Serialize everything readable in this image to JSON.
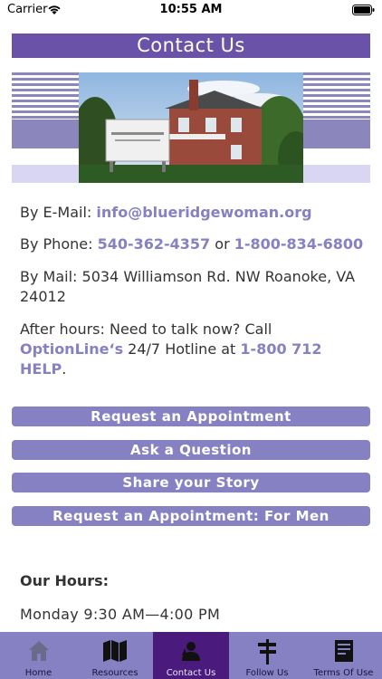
{
  "status": {
    "carrier": "Carrier",
    "time": "10:55 AM"
  },
  "title": "Contact Us",
  "contact": {
    "email_prefix": "By E-Mail: ",
    "email": "info@blueridgewoman.org",
    "phone_prefix": "By Phone: ",
    "phone1": "540-362-4357",
    "phone_or": " or ",
    "phone2": "1-800-834-6800",
    "mail": "By Mail: 5034 Williamson Rd. NW Roanoke, VA 24012",
    "after_prefix": "After hours: Need to talk now? Call ",
    "optionline": "OptionLine‘s",
    "after_mid": " 24/7 Hotline at ",
    "hotline": "1-800 712 HELP",
    "after_end": "."
  },
  "buttons": {
    "appointment": "Request an Appointment",
    "question": "Ask a Question",
    "story": "Share your Story",
    "appointment_men": "Request an Appointment: For Men"
  },
  "hours": {
    "title": "Our Hours:",
    "monday": "Monday 9:30 AM—4:00 PM"
  },
  "tabs": [
    {
      "label": "Home",
      "icon": "home-icon"
    },
    {
      "label": "Resources",
      "icon": "map-icon"
    },
    {
      "label": "Contact Us",
      "icon": "contact-icon",
      "active": true
    },
    {
      "label": "Follow Us",
      "icon": "signpost-icon"
    },
    {
      "label": "Terms Of Use",
      "icon": "document-icon"
    }
  ],
  "colors": {
    "accent": "#6a52a8",
    "button": "#8581c2",
    "active_tab": "#4a1a7d"
  }
}
